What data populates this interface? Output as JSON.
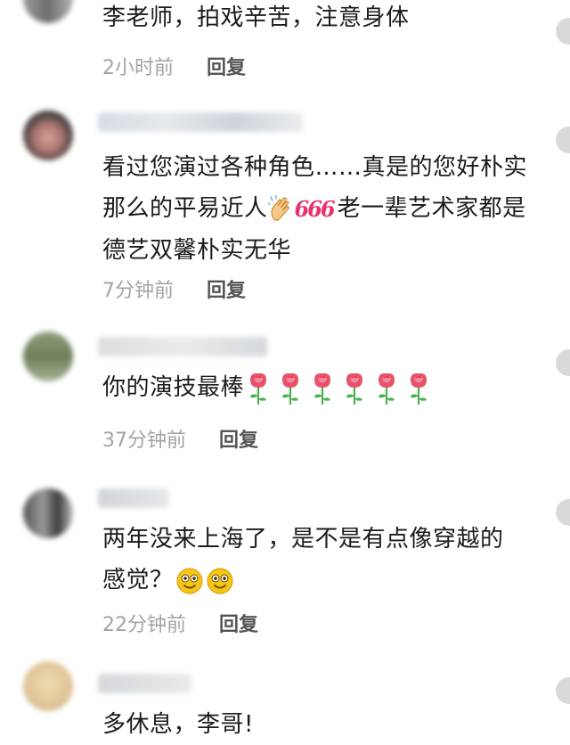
{
  "comments": [
    {
      "text": "李老师，拍戏辛苦，注意身体",
      "time": "2小时前",
      "reply": "回复"
    },
    {
      "text_a": "看过您演过各种角色……真是的您好朴实那么的平易近人",
      "emoji_66": "666",
      "text_b": "老一辈艺术家都是德艺双馨朴实无华",
      "time": "7分钟前",
      "reply": "回复"
    },
    {
      "text": "你的演技最棒",
      "time": "37分钟前",
      "reply": "回复",
      "rose_count": 6
    },
    {
      "text": "两年没来上海了，是不是有点像穿越的感觉？",
      "time": "22分钟前",
      "reply": "回复"
    },
    {
      "text": "多休息，李哥!"
    }
  ],
  "colors": {
    "text": "#1c1c1c",
    "meta": "#a3a3a3",
    "reply": "#555555",
    "rose": "#e8536a",
    "leaf": "#4caf50",
    "smiley": "#f5c518"
  },
  "icons": {
    "clap": "clapping-hands-icon",
    "rose": "rose-icon",
    "smiley": "smiling-face-icon",
    "like": "like-icon"
  }
}
